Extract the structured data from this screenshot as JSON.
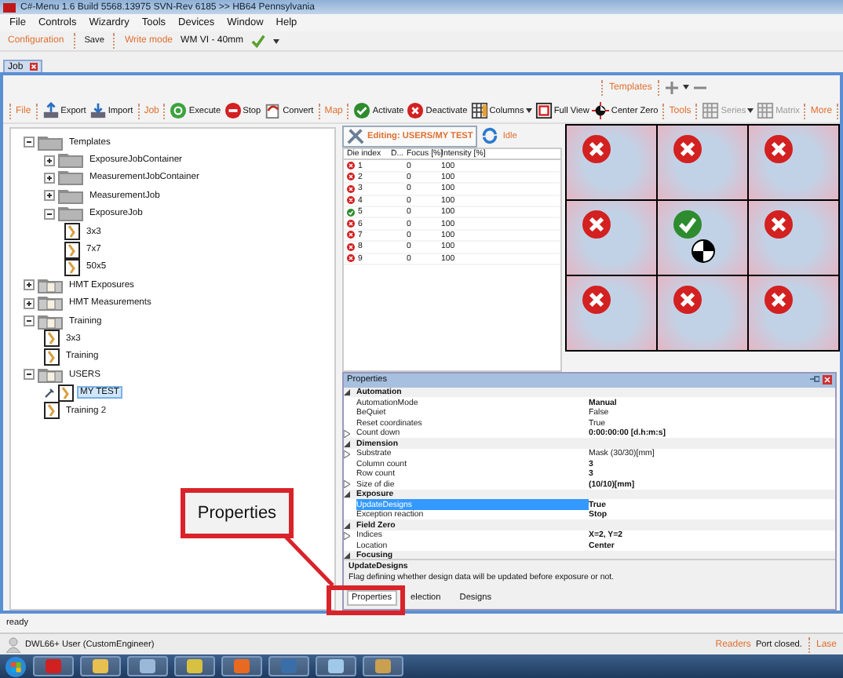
{
  "window": {
    "title": "C#-Menu 1.6 Build 5568.13975 SVN-Rev 6185 >> HB64 Pennsylvania"
  },
  "menu": [
    "File",
    "Controls",
    "Wizardry",
    "Tools",
    "Devices",
    "Window",
    "Help"
  ],
  "config_bar": {
    "section": "Configuration",
    "save": "Save",
    "write_mode_label": "Write mode",
    "write_mode": "WM VI - 40mm"
  },
  "document_tab": {
    "label": "Job"
  },
  "templates_bar": {
    "label": "Templates"
  },
  "toolbar": [
    {
      "kind": "section",
      "label": "File"
    },
    {
      "kind": "button",
      "label": "Export",
      "disabled": false,
      "dropdown": false
    },
    {
      "kind": "button",
      "label": "Import",
      "disabled": false,
      "dropdown": false
    },
    {
      "kind": "section",
      "label": "Job"
    },
    {
      "kind": "button",
      "label": "Execute",
      "disabled": false,
      "dropdown": false
    },
    {
      "kind": "button",
      "label": "Stop",
      "disabled": false,
      "dropdown": false
    },
    {
      "kind": "button",
      "label": "Convert",
      "disabled": false,
      "dropdown": false
    },
    {
      "kind": "section",
      "label": "Map"
    },
    {
      "kind": "button",
      "label": "Activate",
      "disabled": false,
      "dropdown": false
    },
    {
      "kind": "button",
      "label": "Deactivate",
      "disabled": false,
      "dropdown": false
    },
    {
      "kind": "button",
      "label": "Columns",
      "disabled": false,
      "dropdown": true
    },
    {
      "kind": "button",
      "label": "Full View",
      "disabled": false,
      "dropdown": false
    },
    {
      "kind": "button",
      "label": "Center Zero",
      "disabled": false,
      "dropdown": false
    },
    {
      "kind": "section",
      "label": "Tools"
    },
    {
      "kind": "button",
      "label": "Series",
      "disabled": true,
      "dropdown": true
    },
    {
      "kind": "button",
      "label": "Matrix",
      "disabled": true,
      "dropdown": false
    },
    {
      "kind": "section",
      "label": "More"
    }
  ],
  "tree": [
    {
      "label": "Templates",
      "kind": "folder",
      "expanded": true,
      "selected": false,
      "editing": false,
      "children": [
        {
          "label": "ExposureJobContainer",
          "kind": "folder",
          "expanded": false,
          "selected": false,
          "editing": false
        },
        {
          "label": "MeasurementJobContainer",
          "kind": "folder",
          "expanded": false,
          "selected": false,
          "editing": false
        },
        {
          "label": "MeasurementJob",
          "kind": "folder",
          "expanded": false,
          "selected": false,
          "editing": false
        },
        {
          "label": "ExposureJob",
          "kind": "folder",
          "expanded": true,
          "selected": false,
          "editing": false,
          "children": [
            {
              "label": "3x3",
              "kind": "job",
              "selected": false,
              "editing": false
            },
            {
              "label": "7x7",
              "kind": "job",
              "selected": false,
              "editing": false
            },
            {
              "label": "50x5",
              "kind": "job",
              "selected": false,
              "editing": false
            }
          ]
        }
      ]
    },
    {
      "label": "HMT Exposures",
      "kind": "group",
      "expanded": false,
      "selected": false,
      "editing": false
    },
    {
      "label": "HMT Measurements",
      "kind": "group",
      "expanded": false,
      "selected": false,
      "editing": false
    },
    {
      "label": "Training",
      "kind": "group",
      "expanded": true,
      "selected": false,
      "editing": false,
      "children": [
        {
          "label": "3x3",
          "kind": "job",
          "selected": false,
          "editing": false
        },
        {
          "label": "Training",
          "kind": "job",
          "selected": false,
          "editing": false
        }
      ]
    },
    {
      "label": "USERS",
      "kind": "group",
      "expanded": true,
      "selected": false,
      "editing": false,
      "children": [
        {
          "label": "MY TEST",
          "kind": "job",
          "selected": true,
          "editing": true
        },
        {
          "label": "Training 2",
          "kind": "job",
          "selected": false,
          "editing": false
        }
      ]
    }
  ],
  "editing_button": {
    "label": "Editing: USERS/MY TEST"
  },
  "state_button": {
    "label": "Idle"
  },
  "die_table": {
    "columns": [
      "Die index",
      "D...",
      "Focus [%]",
      "Intensity [%]"
    ],
    "rows": [
      {
        "ok": false,
        "index": "1",
        "focus": "0",
        "intensity": "100"
      },
      {
        "ok": false,
        "index": "2",
        "focus": "0",
        "intensity": "100"
      },
      {
        "ok": false,
        "index": "3",
        "focus": "0",
        "intensity": "100"
      },
      {
        "ok": false,
        "index": "4",
        "focus": "0",
        "intensity": "100"
      },
      {
        "ok": true,
        "index": "5",
        "focus": "0",
        "intensity": "100"
      },
      {
        "ok": false,
        "index": "6",
        "focus": "0",
        "intensity": "100"
      },
      {
        "ok": false,
        "index": "7",
        "focus": "0",
        "intensity": "100"
      },
      {
        "ok": false,
        "index": "8",
        "focus": "0",
        "intensity": "100"
      },
      {
        "ok": false,
        "index": "9",
        "focus": "0",
        "intensity": "100"
      }
    ]
  },
  "die_map": [
    {
      "ok": false,
      "origin": false
    },
    {
      "ok": false,
      "origin": false
    },
    {
      "ok": false,
      "origin": false
    },
    {
      "ok": false,
      "origin": false
    },
    {
      "ok": true,
      "origin": true
    },
    {
      "ok": false,
      "origin": false
    },
    {
      "ok": false,
      "origin": false
    },
    {
      "ok": false,
      "origin": false
    },
    {
      "ok": false,
      "origin": false
    }
  ],
  "properties": {
    "title": "Properties",
    "rows": [
      {
        "kind": "category",
        "name": "Automation"
      },
      {
        "kind": "property",
        "name": "AutomationMode",
        "value": "Manual",
        "bold": true,
        "expandable": false,
        "selected": false
      },
      {
        "kind": "property",
        "name": "BeQuiet",
        "value": "False",
        "bold": false,
        "expandable": false,
        "selected": false
      },
      {
        "kind": "property",
        "name": "Reset coordinates",
        "value": "True",
        "bold": false,
        "expandable": false,
        "selected": false
      },
      {
        "kind": "property",
        "name": "Count down",
        "value": "0:00:00:00 [d.h:m:s]",
        "bold": true,
        "expandable": true,
        "selected": false
      },
      {
        "kind": "category",
        "name": "Dimension"
      },
      {
        "kind": "property",
        "name": "Substrate",
        "value": "Mask (30/30)[mm]",
        "bold": false,
        "expandable": true,
        "selected": false
      },
      {
        "kind": "property",
        "name": "Column count",
        "value": "3",
        "bold": true,
        "expandable": false,
        "selected": false
      },
      {
        "kind": "property",
        "name": "Row count",
        "value": "3",
        "bold": true,
        "expandable": false,
        "selected": false
      },
      {
        "kind": "property",
        "name": "Size of die",
        "value": "(10/10)[mm]",
        "bold": true,
        "expandable": true,
        "selected": false
      },
      {
        "kind": "category",
        "name": "Exposure"
      },
      {
        "kind": "property",
        "name": "UpdateDesigns",
        "value": "True",
        "bold": true,
        "expandable": false,
        "selected": true
      },
      {
        "kind": "property",
        "name": "Exception reaction",
        "value": "Stop",
        "bold": true,
        "expandable": false,
        "selected": false
      },
      {
        "kind": "category",
        "name": "Field Zero"
      },
      {
        "kind": "property",
        "name": "Indices",
        "value": "X=2, Y=2",
        "bold": true,
        "expandable": true,
        "selected": false
      },
      {
        "kind": "property",
        "name": "Location",
        "value": "Center",
        "bold": true,
        "expandable": false,
        "selected": false
      },
      {
        "kind": "category",
        "name": "Focusing"
      }
    ],
    "description_title": "UpdateDesigns",
    "description": "Flag defining whether design data will be updated before exposure or not.",
    "tabs": [
      {
        "label": "Properties",
        "selected": true
      },
      {
        "label": "election",
        "selected": false
      },
      {
        "label": "Designs",
        "selected": false
      }
    ]
  },
  "status": "ready",
  "user_bar": {
    "user": "DWL66+ User (CustomEngineer)",
    "readers": "Readers",
    "port": "Port closed.",
    "laser": "Lase"
  },
  "callout": {
    "label": "Properties"
  }
}
